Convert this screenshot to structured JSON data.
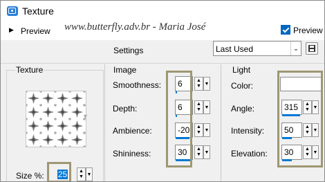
{
  "window": {
    "title": "Texture",
    "app_icon": "image-icon"
  },
  "toolbar": {
    "preview_label": "Preview",
    "watermark": "www.butterfly.adv.br - Maria José",
    "preview_on_image_label": "Preview o",
    "preview_on_image_checked": true
  },
  "settings": {
    "label": "Settings",
    "selected": "Last Used"
  },
  "texture_group": {
    "title": "Texture",
    "size_label": "Size %:",
    "size_value": "25"
  },
  "image_group": {
    "title": "Image",
    "smoothness_label": "Smoothness:",
    "smoothness_value": "6",
    "depth_label": "Depth:",
    "depth_value": "6",
    "ambience_label": "Ambience:",
    "ambience_value": "-20",
    "shininess_label": "Shininess:",
    "shininess_value": "30"
  },
  "light_group": {
    "title": "Light",
    "color_label": "Color:",
    "color_value": "#ffffff",
    "angle_label": "Angle:",
    "angle_value": "315",
    "intensity_label": "Intensity:",
    "intensity_value": "50",
    "elevation_label": "Elevation:",
    "elevation_value": "30"
  },
  "colors": {
    "highlight": "#9e9773",
    "accent": "#0078d4",
    "background": "#f0f0f0"
  }
}
